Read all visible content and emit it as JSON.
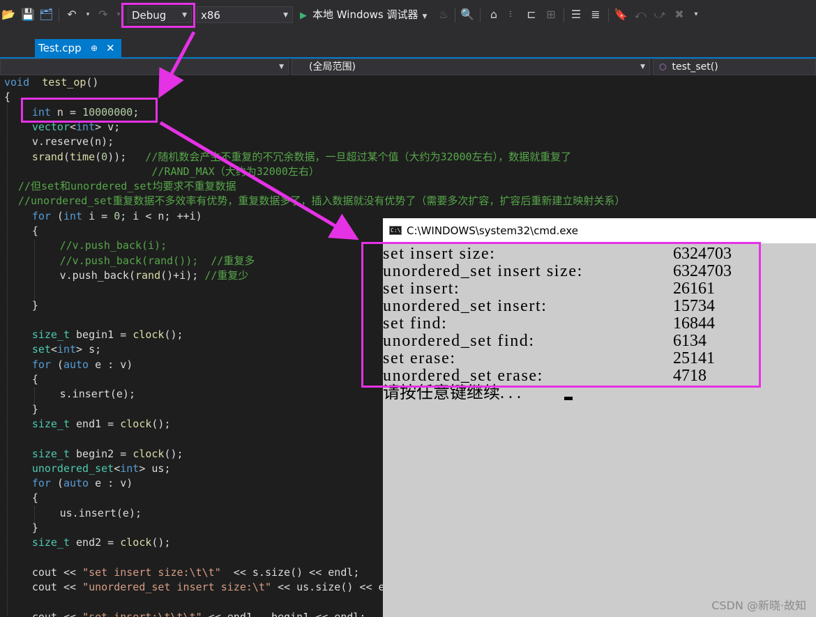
{
  "toolbar": {
    "config_value": "Debug",
    "platform_value": "x86",
    "run_label": "本地 Windows 调试器"
  },
  "tabs": [
    {
      "label": "Test.cpp",
      "pin": "⊕",
      "close": "✕"
    }
  ],
  "navbar": {
    "scope": "(全局范围)",
    "member": "test_set()"
  },
  "code": [
    {
      "indent": 0,
      "parts": [
        [
          "kw",
          "void"
        ],
        [
          "",
          "  "
        ],
        [
          "fn",
          "test_op"
        ],
        [
          "",
          "()"
        ]
      ]
    },
    {
      "indent": 0,
      "parts": [
        [
          "",
          "{"
        ]
      ]
    },
    {
      "indent": 2,
      "parts": [
        [
          "kw",
          "int"
        ],
        [
          "",
          " n = "
        ],
        [
          "num",
          "10000000"
        ],
        [
          "",
          ";"
        ]
      ]
    },
    {
      "indent": 2,
      "parts": [
        [
          "ty",
          "vector"
        ],
        [
          "",
          "<"
        ],
        [
          "kw",
          "int"
        ],
        [
          "",
          "> v;"
        ]
      ]
    },
    {
      "indent": 2,
      "parts": [
        [
          "",
          "v.reserve(n);"
        ]
      ]
    },
    {
      "indent": 2,
      "parts": [
        [
          "fn",
          "srand"
        ],
        [
          "",
          "("
        ],
        [
          "fn",
          "time"
        ],
        [
          "",
          "("
        ],
        [
          "num",
          "0"
        ],
        [
          "",
          "));   "
        ],
        [
          "cm",
          "//随机数会产生不重复的不冗余数据，一旦超过某个值（大约为32000左右），数据就重复了"
        ]
      ]
    },
    {
      "indent": 2,
      "parts": [
        [
          "",
          "                   "
        ],
        [
          "cm",
          "//RAND_MAX（大约为32000左右）"
        ]
      ]
    },
    {
      "indent": 1,
      "parts": [
        [
          "cm",
          "//但set和unordered_set均要求不重复数据"
        ]
      ]
    },
    {
      "indent": 1,
      "parts": [
        [
          "cm",
          "//unordered_set重复数据不多效率有优势，重复数据多了，插入数据就没有优势了（需要多次扩容，扩容后重新建立映射关系）"
        ]
      ]
    },
    {
      "indent": 2,
      "parts": [
        [
          "kw",
          "for"
        ],
        [
          "",
          " ("
        ],
        [
          "kw",
          "int"
        ],
        [
          "",
          " i = "
        ],
        [
          "num",
          "0"
        ],
        [
          "",
          "; i < n; ++i)"
        ]
      ]
    },
    {
      "indent": 2,
      "parts": [
        [
          "",
          "{"
        ]
      ]
    },
    {
      "indent": 4,
      "parts": [
        [
          "cm",
          "//v.push_back(i);"
        ]
      ]
    },
    {
      "indent": 4,
      "parts": [
        [
          "cm",
          "//v.push_back(rand());  //重复多"
        ]
      ]
    },
    {
      "indent": 4,
      "parts": [
        [
          "",
          "v.push_back("
        ],
        [
          "fn",
          "rand"
        ],
        [
          "",
          "()+i); "
        ],
        [
          "cm",
          "//重复少"
        ]
      ]
    },
    {
      "indent": 4,
      "parts": [
        [
          "",
          ""
        ]
      ]
    },
    {
      "indent": 2,
      "parts": [
        [
          "",
          "}"
        ]
      ]
    },
    {
      "indent": 0,
      "parts": [
        [
          "",
          ""
        ]
      ]
    },
    {
      "indent": 2,
      "parts": [
        [
          "ty",
          "size_t"
        ],
        [
          "",
          " begin1 = "
        ],
        [
          "fn",
          "clock"
        ],
        [
          "",
          "();"
        ]
      ]
    },
    {
      "indent": 2,
      "parts": [
        [
          "ty",
          "set"
        ],
        [
          "",
          "<"
        ],
        [
          "kw",
          "int"
        ],
        [
          "",
          "> s;"
        ]
      ]
    },
    {
      "indent": 2,
      "parts": [
        [
          "kw",
          "for"
        ],
        [
          "",
          " ("
        ],
        [
          "kw",
          "auto"
        ],
        [
          "",
          " e : v)"
        ]
      ]
    },
    {
      "indent": 2,
      "parts": [
        [
          "",
          "{"
        ]
      ]
    },
    {
      "indent": 4,
      "parts": [
        [
          "",
          "s.insert(e);"
        ]
      ]
    },
    {
      "indent": 2,
      "parts": [
        [
          "",
          "}"
        ]
      ]
    },
    {
      "indent": 2,
      "parts": [
        [
          "ty",
          "size_t"
        ],
        [
          "",
          " end1 = "
        ],
        [
          "fn",
          "clock"
        ],
        [
          "",
          "();"
        ]
      ]
    },
    {
      "indent": 0,
      "parts": [
        [
          "",
          ""
        ]
      ]
    },
    {
      "indent": 2,
      "parts": [
        [
          "ty",
          "size_t"
        ],
        [
          "",
          " begin2 = "
        ],
        [
          "fn",
          "clock"
        ],
        [
          "",
          "();"
        ]
      ]
    },
    {
      "indent": 2,
      "parts": [
        [
          "ty",
          "unordered_set"
        ],
        [
          "",
          "<"
        ],
        [
          "kw",
          "int"
        ],
        [
          "",
          "> us;"
        ]
      ]
    },
    {
      "indent": 2,
      "parts": [
        [
          "kw",
          "for"
        ],
        [
          "",
          " ("
        ],
        [
          "kw",
          "auto"
        ],
        [
          "",
          " e : v)"
        ]
      ]
    },
    {
      "indent": 2,
      "parts": [
        [
          "",
          "{"
        ]
      ]
    },
    {
      "indent": 4,
      "parts": [
        [
          "",
          "us.insert(e);"
        ]
      ]
    },
    {
      "indent": 2,
      "parts": [
        [
          "",
          "}"
        ]
      ]
    },
    {
      "indent": 2,
      "parts": [
        [
          "ty",
          "size_t"
        ],
        [
          "",
          " end2 = "
        ],
        [
          "fn",
          "clock"
        ],
        [
          "",
          "();"
        ]
      ]
    },
    {
      "indent": 0,
      "parts": [
        [
          "",
          ""
        ]
      ]
    },
    {
      "indent": 2,
      "parts": [
        [
          "",
          "cout << "
        ],
        [
          "str",
          "\"set insert size:\\t\\t\""
        ],
        [
          "",
          "  << s.size() << endl;"
        ]
      ]
    },
    {
      "indent": 2,
      "parts": [
        [
          "",
          "cout << "
        ],
        [
          "str",
          "\"unordered_set insert size:\\t\""
        ],
        [
          "",
          " << us.size() << endl;"
        ]
      ]
    },
    {
      "indent": 0,
      "parts": [
        [
          "",
          ""
        ]
      ]
    },
    {
      "indent": 2,
      "parts": [
        [
          "",
          "cout << "
        ],
        [
          "str",
          "\"set insert:\\t\\t\\t\""
        ],
        [
          "",
          " << end1 - begin1 << endl;"
        ]
      ]
    }
  ],
  "console": {
    "title": "C:\\WINDOWS\\system32\\cmd.exe",
    "icon_text": "C:\\",
    "rows": [
      {
        "label": "set insert size:",
        "value": "6324703"
      },
      {
        "label": "unordered_set insert size:",
        "value": "6324703"
      },
      {
        "label": "set insert:",
        "value": "26161"
      },
      {
        "label": "unordered_set insert:",
        "value": "15734"
      },
      {
        "label": "set find:",
        "value": "16844"
      },
      {
        "label": "unordered_set find:",
        "value": "6134"
      },
      {
        "label": "set erase:",
        "value": "25141"
      },
      {
        "label": "unordered_set erase:",
        "value": "4718"
      }
    ],
    "prompt": "请按任意键继续. . ."
  },
  "watermark": "CSDN @新晓·故知",
  "colors": {
    "highlight": "#e532e5",
    "accent": "#007acc"
  }
}
